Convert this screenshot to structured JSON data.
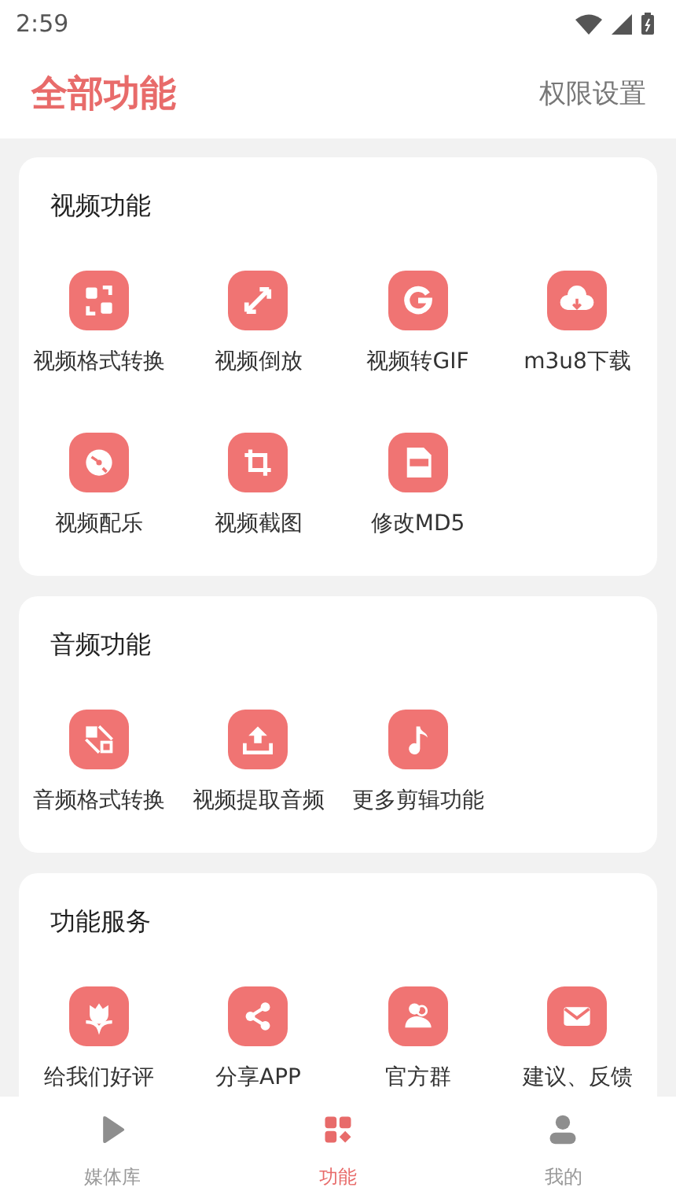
{
  "status_bar": {
    "time": "2:59"
  },
  "header": {
    "title": "全部功能",
    "action": "权限设置"
  },
  "sections": [
    {
      "title": "视频功能",
      "items": [
        {
          "label": "视频格式转换"
        },
        {
          "label": "视频倒放"
        },
        {
          "label": "视频转GIF"
        },
        {
          "label": "m3u8下载"
        },
        {
          "label": "视频配乐"
        },
        {
          "label": "视频截图"
        },
        {
          "label": "修改MD5"
        }
      ]
    },
    {
      "title": "音频功能",
      "items": [
        {
          "label": "音频格式转换"
        },
        {
          "label": "视频提取音频"
        },
        {
          "label": "更多剪辑功能"
        }
      ]
    },
    {
      "title": "功能服务",
      "items": [
        {
          "label": "给我们好评"
        },
        {
          "label": "分享APP"
        },
        {
          "label": "官方群"
        },
        {
          "label": "建议、反馈"
        }
      ]
    }
  ],
  "bottom_nav": [
    {
      "label": "媒体库",
      "selected": false
    },
    {
      "label": "功能",
      "selected": true
    },
    {
      "label": "我的",
      "selected": false
    }
  ]
}
